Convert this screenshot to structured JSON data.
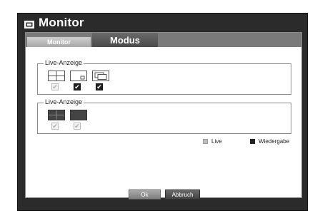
{
  "window": {
    "title": "Monitor",
    "title_icon": "monitor-icon"
  },
  "tabs": [
    {
      "label": "Monitor",
      "active": false
    },
    {
      "label": "Modus",
      "active": true
    }
  ],
  "groups": [
    {
      "legend": "Live-Anzeige",
      "icons": [
        "grid-layout-icon",
        "single-view-icon",
        "overlay-windows-icon"
      ],
      "checks": [
        {
          "checked": true,
          "disabled": true
        },
        {
          "checked": true,
          "disabled": false
        },
        {
          "checked": true,
          "disabled": false
        }
      ]
    },
    {
      "legend": "Live-Anzeige",
      "icons": [
        "grid-layout-dark-icon",
        "single-view-dark-icon"
      ],
      "checks": [
        {
          "checked": true,
          "disabled": true
        },
        {
          "checked": true,
          "disabled": true
        }
      ]
    }
  ],
  "legend_items": {
    "live": {
      "label": "Live",
      "color": "#bdbdbd"
    },
    "playback": {
      "label": "Wiedergabe",
      "color": "#222222"
    }
  },
  "buttons": {
    "ok": "Ok",
    "cancel": "Abbruch"
  },
  "colors": {
    "window_bg": "#2b2b2b",
    "tab_strip": "#7a7a7a"
  }
}
